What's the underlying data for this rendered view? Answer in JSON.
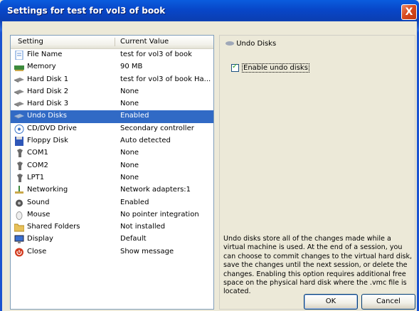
{
  "window": {
    "title": "Settings for test for vol3 of book",
    "close_glyph": "X"
  },
  "list": {
    "col_setting": "Setting",
    "col_value": "Current Value",
    "rows": [
      {
        "setting": "File Name",
        "value": "test for vol3 of book",
        "icon": "file-icon",
        "color": "#5d8fd6"
      },
      {
        "setting": "Memory",
        "value": "90 MB",
        "icon": "memory-icon",
        "color": "#3c8a3c"
      },
      {
        "setting": "Hard Disk 1",
        "value": "test for vol3 of book Ha...",
        "icon": "hard-disk-icon",
        "color": "#8a8a8a"
      },
      {
        "setting": "Hard Disk 2",
        "value": "None",
        "icon": "hard-disk-icon",
        "color": "#8a8a8a"
      },
      {
        "setting": "Hard Disk 3",
        "value": "None",
        "icon": "hard-disk-icon",
        "color": "#8a8a8a"
      },
      {
        "setting": "Undo Disks",
        "value": "Enabled",
        "icon": "undo-disk-icon",
        "color": "#9fb6d6",
        "selected": true
      },
      {
        "setting": "CD/DVD Drive",
        "value": "Secondary controller",
        "icon": "cd-icon",
        "color": "#3a74c8"
      },
      {
        "setting": "Floppy Disk",
        "value": "Auto detected",
        "icon": "floppy-icon",
        "color": "#2d56b8"
      },
      {
        "setting": "COM1",
        "value": "None",
        "icon": "com-port-icon",
        "color": "#6b6b6b"
      },
      {
        "setting": "COM2",
        "value": "None",
        "icon": "com-port-icon",
        "color": "#6b6b6b"
      },
      {
        "setting": "LPT1",
        "value": "None",
        "icon": "lpt-port-icon",
        "color": "#6b6b6b"
      },
      {
        "setting": "Networking",
        "value": "Network adapters:1",
        "icon": "network-icon",
        "color": "#3d8a3d"
      },
      {
        "setting": "Sound",
        "value": "Enabled",
        "icon": "sound-icon",
        "color": "#555555"
      },
      {
        "setting": "Mouse",
        "value": "No pointer integration",
        "icon": "mouse-icon",
        "color": "#a0a0a0"
      },
      {
        "setting": "Shared Folders",
        "value": "Not installed",
        "icon": "folder-icon",
        "color": "#e8c15a"
      },
      {
        "setting": "Display",
        "value": "Default",
        "icon": "display-icon",
        "color": "#3a6fd0"
      },
      {
        "setting": "Close",
        "value": "Show message",
        "icon": "close-icon",
        "color": "#d23a1e"
      }
    ]
  },
  "panel": {
    "section_title": "Undo Disks",
    "checkbox_label": "Enable undo disks",
    "checkbox_checked": true,
    "description": "Undo disks store all of the changes made while a virtual machine is used. At the end of a session, you can choose to commit changes to the virtual hard disk, save the changes until the next session, or delete the changes. Enabling this option requires additional free space on the physical hard disk where the .vmc file is located."
  },
  "buttons": {
    "ok": "OK",
    "cancel": "Cancel"
  }
}
